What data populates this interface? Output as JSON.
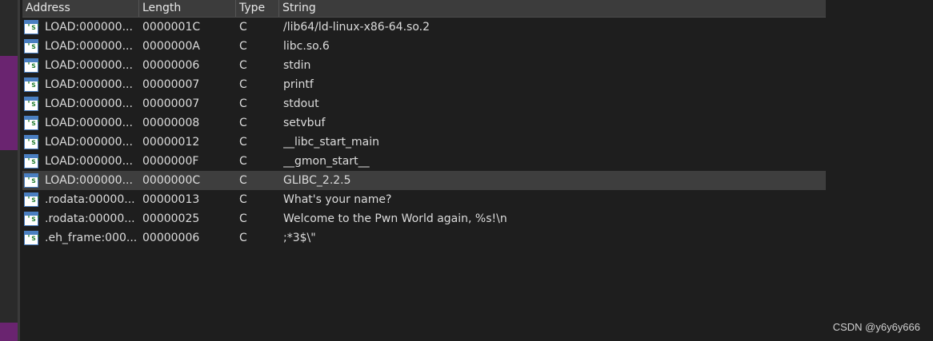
{
  "columns": {
    "address": "Address",
    "length": "Length",
    "type": "Type",
    "string": "String"
  },
  "rows": [
    {
      "address": "LOAD:000000...",
      "length": "0000001C",
      "type": "C",
      "string": "/lib64/ld-linux-x86-64.so.2",
      "icon": "string-icon"
    },
    {
      "address": "LOAD:000000...",
      "length": "0000000A",
      "type": "C",
      "string": "libc.so.6",
      "icon": "string-icon"
    },
    {
      "address": "LOAD:000000...",
      "length": "00000006",
      "type": "C",
      "string": "stdin",
      "icon": "string-icon"
    },
    {
      "address": "LOAD:000000...",
      "length": "00000007",
      "type": "C",
      "string": "printf",
      "icon": "string-icon"
    },
    {
      "address": "LOAD:000000...",
      "length": "00000007",
      "type": "C",
      "string": "stdout",
      "icon": "string-icon"
    },
    {
      "address": "LOAD:000000...",
      "length": "00000008",
      "type": "C",
      "string": "setvbuf",
      "icon": "string-icon"
    },
    {
      "address": "LOAD:000000...",
      "length": "00000012",
      "type": "C",
      "string": "__libc_start_main",
      "icon": "string-icon"
    },
    {
      "address": "LOAD:000000...",
      "length": "0000000F",
      "type": "C",
      "string": "__gmon_start__",
      "icon": "string-icon"
    },
    {
      "address": "LOAD:000000...",
      "length": "0000000C",
      "type": "C",
      "string": "GLIBC_2.2.5",
      "icon": "string-icon",
      "selected": true
    },
    {
      "address": ".rodata:00000...",
      "length": "00000013",
      "type": "C",
      "string": "What's your name?",
      "icon": "string-icon"
    },
    {
      "address": ".rodata:00000...",
      "length": "00000025",
      "type": "C",
      "string": "Welcome to the Pwn World again, %s!\\n",
      "icon": "string-icon"
    },
    {
      "address": ".eh_frame:000...",
      "length": "00000006",
      "type": "C",
      "string": ";*3$\\\"",
      "icon": "string-icon"
    }
  ],
  "icon_glyph": "'s'",
  "watermark": "CSDN @y6y6y666",
  "colors": {
    "background": "#1e1e1e",
    "header": "#3c3c3c",
    "selected_row": "#3e3e3e",
    "gutter_mark": "#6a2470"
  }
}
